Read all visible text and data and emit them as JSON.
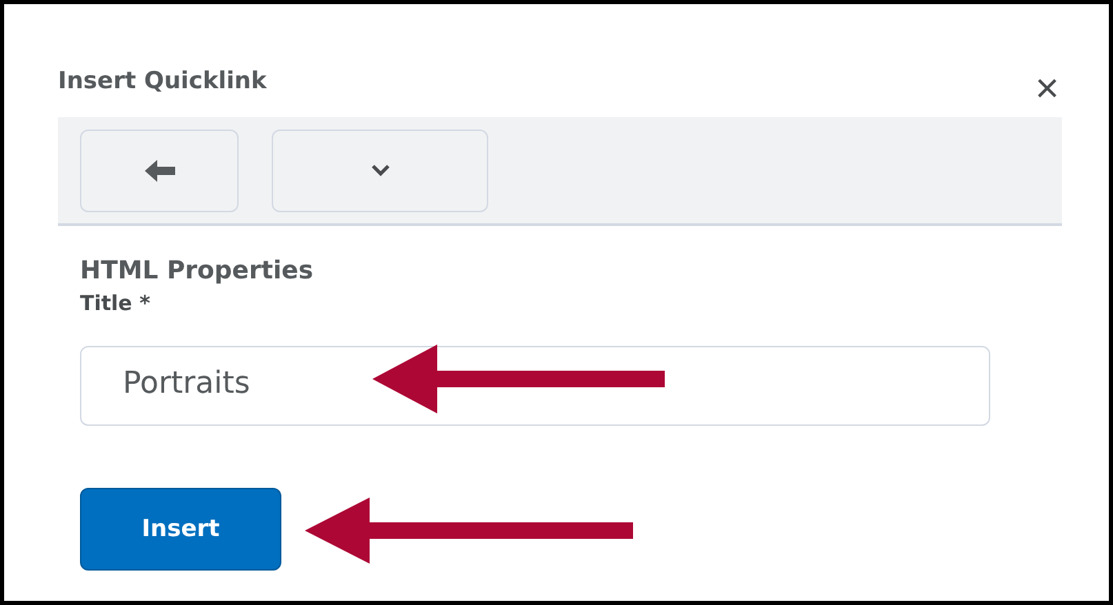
{
  "dialog": {
    "title": "Insert Quicklink",
    "close": "×"
  },
  "toolbar": {
    "buttons": [
      {
        "kind": "back"
      },
      {
        "kind": "dropdown"
      }
    ]
  },
  "section": {
    "heading": "HTML Properties",
    "field_label": "Title *"
  },
  "title_field": {
    "value": "Portraits"
  },
  "buttons": [
    "Insert"
  ]
}
